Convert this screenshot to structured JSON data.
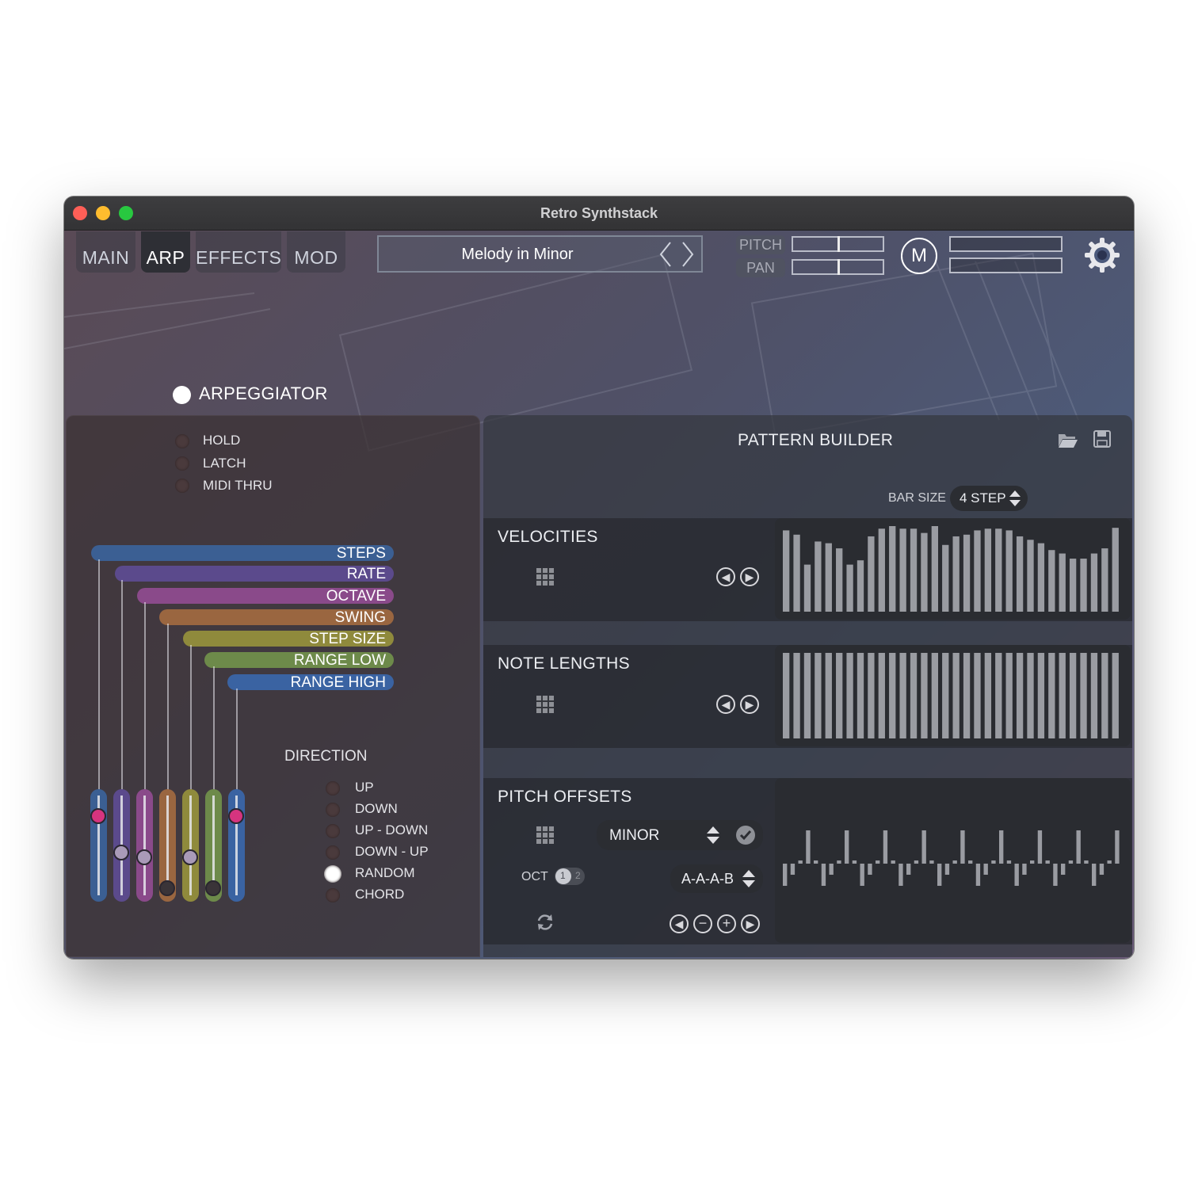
{
  "window": {
    "title": "Retro Synthstack"
  },
  "tabs": [
    {
      "label": "MAIN",
      "active": false
    },
    {
      "label": "ARP",
      "active": true
    },
    {
      "label": "EFFECTS",
      "active": false
    },
    {
      "label": "MOD",
      "active": false
    }
  ],
  "preset": {
    "name": "Melody in Minor"
  },
  "header": {
    "pitch_label": "PITCH",
    "pan_label": "PAN",
    "m_button": "M"
  },
  "arpeggiator": {
    "label": "ARPEGGIATOR",
    "enabled": true,
    "options": [
      {
        "label": "HOLD",
        "on": false
      },
      {
        "label": "LATCH",
        "on": false
      },
      {
        "label": "MIDI THRU",
        "on": false
      }
    ],
    "params": [
      {
        "label": "STEPS",
        "color": "#3b5f93",
        "level": 0.86,
        "knob_color": "#d6347f"
      },
      {
        "label": "RATE",
        "color": "#5b4a8c",
        "level": 0.46,
        "knob_color": "#a99ab8"
      },
      {
        "label": "OCTAVE",
        "color": "#8a4a8a",
        "level": 0.4,
        "knob_color": "#a99ab8"
      },
      {
        "label": "SWING",
        "color": "#9a6640",
        "level": 0.06,
        "knob_color": "#3a3438"
      },
      {
        "label": "STEP SIZE",
        "color": "#8f8a3c",
        "level": 0.4,
        "knob_color": "#a99ab8"
      },
      {
        "label": "RANGE LOW",
        "color": "#6d8a4a",
        "level": 0.06,
        "knob_color": "#3a3438"
      },
      {
        "label": "RANGE HIGH",
        "color": "#3a63a2",
        "level": 0.86,
        "knob_color": "#d6347f"
      }
    ],
    "direction": {
      "title": "DIRECTION",
      "options": [
        {
          "label": "UP",
          "selected": false
        },
        {
          "label": "DOWN",
          "selected": false
        },
        {
          "label": "UP - DOWN",
          "selected": false
        },
        {
          "label": "DOWN - UP",
          "selected": false
        },
        {
          "label": "RANDOM",
          "selected": true
        },
        {
          "label": "CHORD",
          "selected": false
        }
      ]
    }
  },
  "pattern_builder": {
    "title": "PATTERN BUILDER",
    "bar_size_label": "BAR SIZE",
    "bar_size_value": "4 STEP",
    "velocities": {
      "title": "VELOCITIES",
      "values": [
        95,
        90,
        55,
        82,
        80,
        74,
        55,
        60,
        88,
        97,
        100,
        97,
        97,
        92,
        100,
        78,
        88,
        90,
        95,
        97,
        97,
        95,
        88,
        84,
        80,
        72,
        68,
        62,
        62,
        68,
        74,
        98
      ]
    },
    "note_lengths": {
      "title": "NOTE LENGTHS",
      "values": [
        100,
        100,
        100,
        100,
        100,
        100,
        100,
        100,
        100,
        100,
        100,
        100,
        100,
        100,
        100,
        100,
        100,
        100,
        100,
        100,
        100,
        100,
        100,
        100,
        100,
        100,
        100,
        100,
        100,
        100,
        100,
        100
      ]
    },
    "pitch_offsets": {
      "title": "PITCH OFFSETS",
      "scale": "MINOR",
      "oct_label": "OCT",
      "oct_options": [
        "1",
        "2"
      ],
      "oct_selected": "1",
      "pattern": "A-A-A-B",
      "values": [
        -2,
        -1,
        0,
        3,
        0,
        -2,
        -1,
        0,
        3,
        0,
        -2,
        -1,
        0,
        3,
        0,
        -2,
        -1,
        0,
        3,
        0,
        -2,
        -1,
        0,
        3,
        0,
        -2,
        -1,
        0,
        3,
        0,
        -2,
        -1,
        0,
        3,
        0,
        -2,
        -1,
        0,
        3,
        0,
        -2,
        -1,
        0,
        3
      ]
    }
  },
  "colors": {
    "accent": "#d6347f",
    "panel": "#34383e",
    "bar": "#9a9ca2"
  }
}
